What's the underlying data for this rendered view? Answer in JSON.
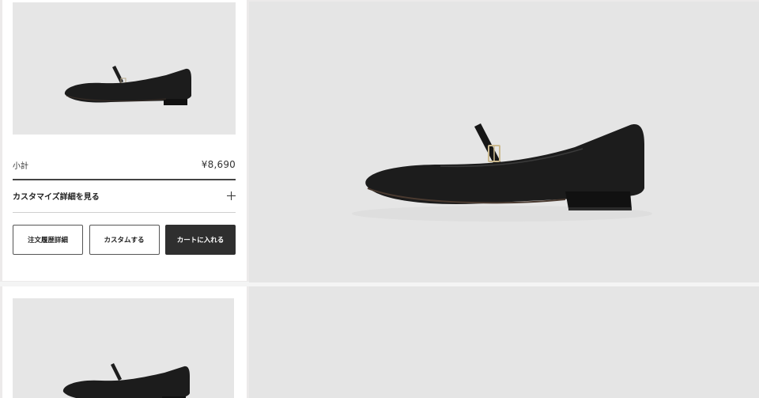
{
  "product_card": {
    "size_label": "小計",
    "price": "¥8,690",
    "details_label": "カスタマイズ詳細を見る",
    "buttons": {
      "order_history": "注文履歴詳細",
      "customize": "カスタムする",
      "add_to_cart": "カートに入れる"
    },
    "image_alt_icon": "mary-jane-flat-shoe"
  },
  "colors": {
    "shoe": "#1c1c1c",
    "image_bg": "#e6e6e6",
    "primary_button": "#2f2f2f"
  }
}
